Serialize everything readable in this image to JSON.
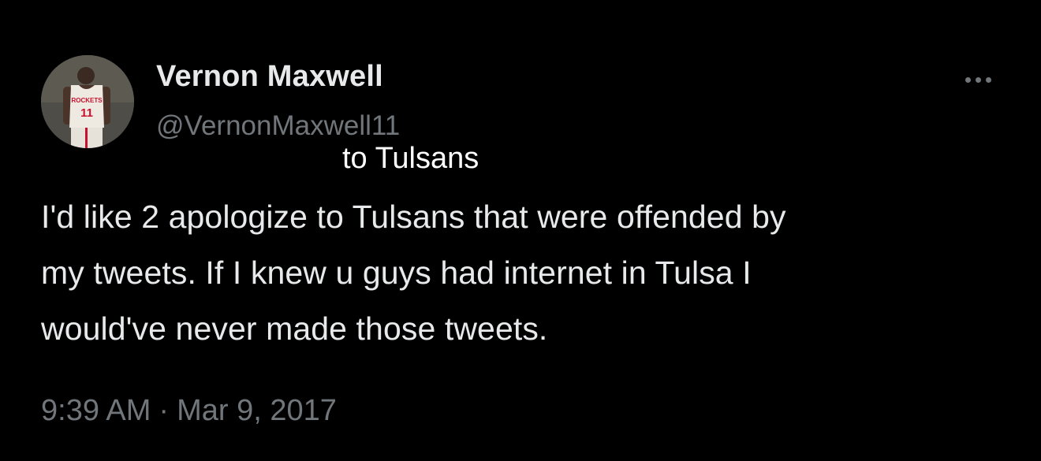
{
  "author": {
    "display_name": "Vernon Maxwell",
    "handle": "@VernonMaxwell11",
    "avatar_icon": "player-photo-avatar",
    "jersey_text": "ROCKETS 11"
  },
  "menu": {
    "icon": "more-options-icon"
  },
  "tweet": {
    "correction_overlay": "to Tulsans",
    "text": "I'd like 2 apologize to Tulsans that were offended by\nmy tweets. If I knew u guys had internet in Tulsa I\nwould've never made those tweets.",
    "time": "9:39 AM",
    "separator": "·",
    "date": "Mar 9, 2017"
  },
  "colors": {
    "background": "#000000",
    "primary_text": "#e7e9ea",
    "secondary_text": "#71767b"
  }
}
